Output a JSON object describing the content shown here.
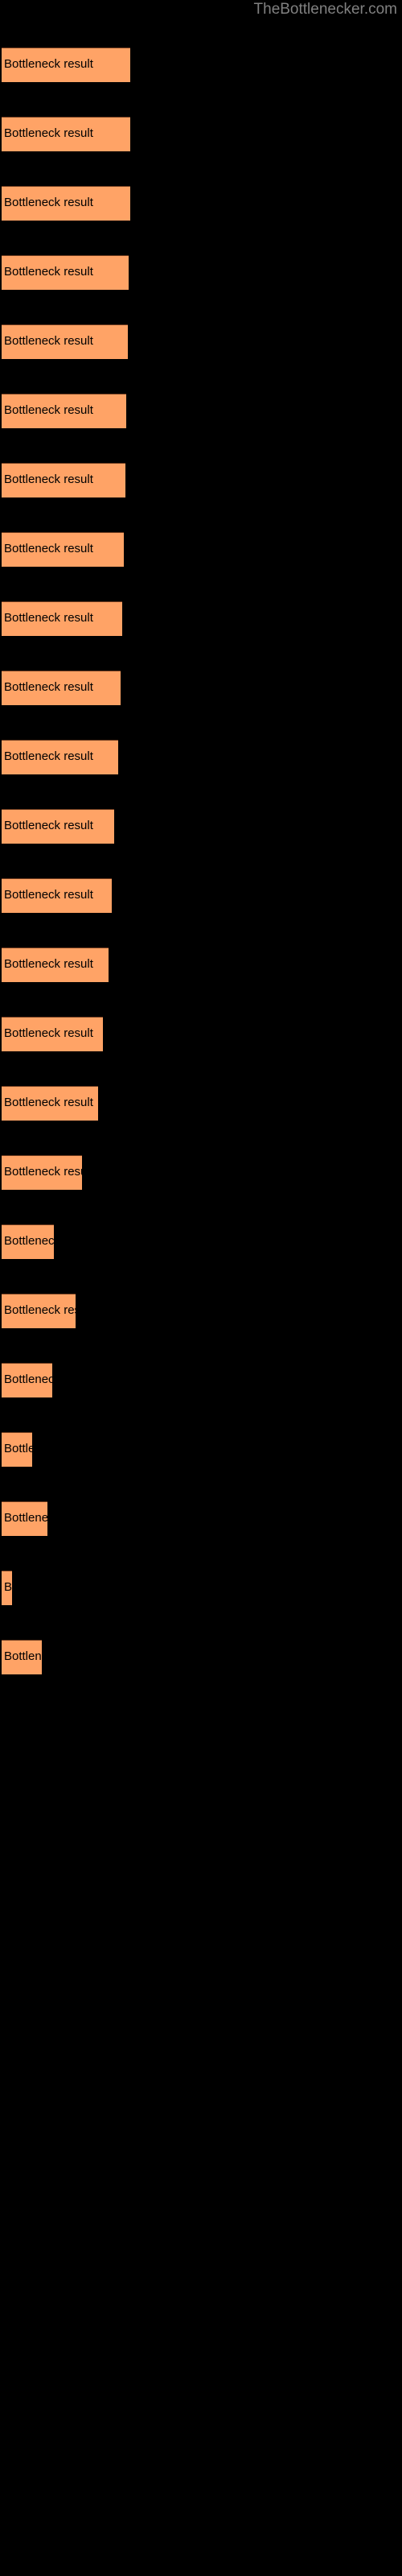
{
  "header": {
    "site_title": "TheBottlenecker.com"
  },
  "colors": {
    "background": "#000000",
    "bar_fill": "#ffa366",
    "bar_border_top": "#6b3a1e",
    "bar_label_text": "#000000",
    "site_title_text": "#808080"
  },
  "chart_data": {
    "type": "bar",
    "orientation": "horizontal",
    "title": "TheBottlenecker.com",
    "xlabel": "",
    "ylabel": "",
    "grid": false,
    "legend": null,
    "bar_label_text": "Bottleneck result",
    "categories": [
      "Bottleneck result",
      "Bottleneck result",
      "Bottleneck result",
      "Bottleneck result",
      "Bottleneck result",
      "Bottleneck result",
      "Bottleneck result",
      "Bottleneck result",
      "Bottleneck result",
      "Bottleneck result",
      "Bottleneck result",
      "Bottleneck result",
      "Bottleneck result",
      "Bottleneck result",
      "Bottleneck result",
      "Bottleneck result",
      "Bottleneck result",
      "Bottleneck result",
      "Bottleneck result",
      "Bottleneck result",
      "Bottleneck result",
      "Bottleneck result",
      "Bottleneck result",
      "Bottleneck result"
    ],
    "values": [
      160,
      160,
      160,
      158,
      157,
      155,
      154,
      152,
      150,
      148,
      145,
      140,
      137,
      133,
      126,
      120,
      100,
      65,
      92,
      63,
      38,
      57,
      13,
      50
    ],
    "xlim": [
      0,
      500
    ],
    "bar_tops": [
      59,
      102,
      145,
      188,
      231,
      274,
      317,
      360,
      403,
      446,
      489,
      532,
      575,
      618,
      661,
      704,
      747,
      790,
      833,
      876,
      919,
      962,
      1005,
      1048
    ]
  }
}
